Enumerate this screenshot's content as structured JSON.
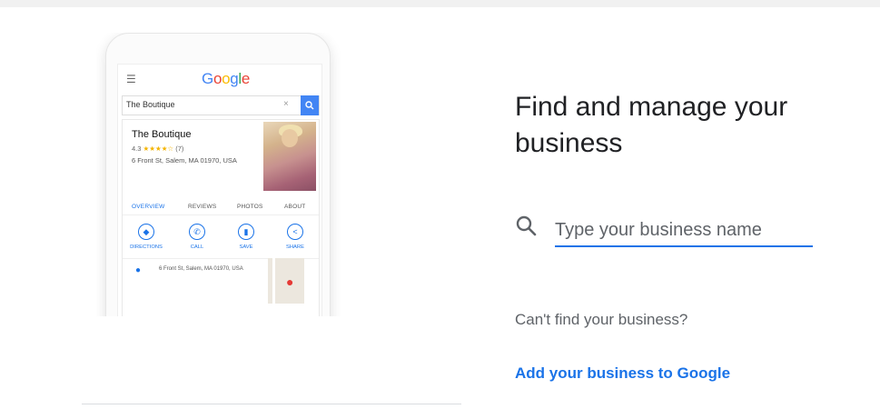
{
  "phone": {
    "logo": [
      "G",
      "o",
      "o",
      "g",
      "l",
      "e"
    ],
    "menu_icon": "menu-icon",
    "search_query": "The Boutique",
    "clear_glyph": "×",
    "search_glyph": "🔍",
    "business": {
      "name": "The Boutique",
      "rating": "4.3",
      "stars": "★★★★☆",
      "review_count": "(7)",
      "address": "6 Front St, Salem, MA 01970, USA"
    },
    "tabs": [
      "OVERVIEW",
      "REVIEWS",
      "PHOTOS",
      "ABOUT"
    ],
    "actions": [
      {
        "label": "DIRECTIONS",
        "icon": "directions-icon",
        "glyph": "◆"
      },
      {
        "label": "CALL",
        "icon": "phone-icon",
        "glyph": "✆"
      },
      {
        "label": "SAVE",
        "icon": "bookmark-icon",
        "glyph": "▮"
      },
      {
        "label": "SHARE",
        "icon": "share-icon",
        "glyph": "<"
      }
    ],
    "info_address": "6 Front St, Salem, MA 01970, USA"
  },
  "heading": "Find and manage your business",
  "search": {
    "placeholder": "Type your business name",
    "value": ""
  },
  "cant_find_text": "Can't find your business?",
  "add_link": "Add your business to Google",
  "colors": {
    "accent": "#1a73e8",
    "text": "#202124",
    "muted": "#5f6368"
  }
}
